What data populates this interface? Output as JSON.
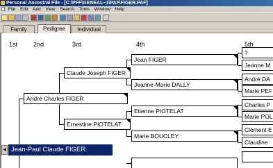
{
  "window": {
    "title": "Personal Ancestral File - [C:\\PFF\\GENEAL~1\\PAF\\FIGER.PAF]"
  },
  "menu": [
    "File",
    "Edit",
    "Add",
    "View",
    "Search",
    "Tools",
    "Window",
    "Help"
  ],
  "tabs": [
    {
      "label": "Family",
      "active": false
    },
    {
      "label": "Pedigree",
      "active": true
    },
    {
      "label": "Individual",
      "active": false
    }
  ],
  "generations": [
    "1st",
    "2nd",
    "3rd",
    "4th",
    "5th"
  ],
  "people": {
    "p1": "Jean-Paul Claude FIGER",
    "p2": "André Charles FIGER",
    "p3": "Claude Joseph FIGER",
    "p4": "Ernestine PIOTELAT",
    "p5": "Jean FIGER",
    "p6": "Jeanne-Marie DALLY",
    "p7": "Etienne PIOTELAT",
    "p8": "Marie BOUCLEY",
    "p9": "?",
    "p10": "Jeanne M",
    "p11": "André DA",
    "p12": "Marie PEF",
    "p13": "Charles P",
    "p14": "Marie POL",
    "p15": "Clément E",
    "p16": "Claudine",
    "p17": "",
    "p18": ""
  },
  "colors": {
    "selection": "#0a246a",
    "titlebar": "#0a246a",
    "chrome": "#d4d0c8"
  }
}
